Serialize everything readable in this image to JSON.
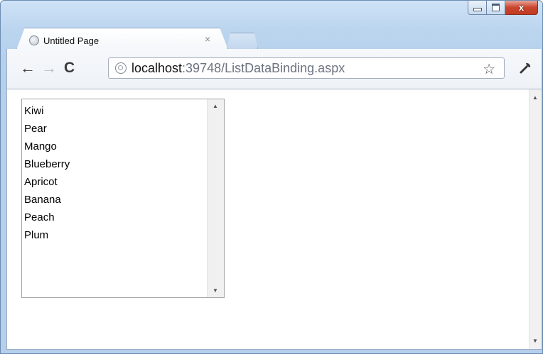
{
  "tab": {
    "title": "Untitled Page",
    "close": "×"
  },
  "toolbar": {
    "back_icon": "←",
    "forward_icon": "→",
    "reload_icon": "C",
    "url_host": "localhost",
    "url_rest": ":39748/ListDataBinding.aspx",
    "star_icon": "☆",
    "wrench_icon": "wrench-icon"
  },
  "window": {
    "close_label": "x"
  },
  "listbox": {
    "items": [
      "Kiwi",
      "Pear",
      "Mango",
      "Blueberry",
      "Apricot",
      "Banana",
      "Peach",
      "Plum"
    ]
  }
}
